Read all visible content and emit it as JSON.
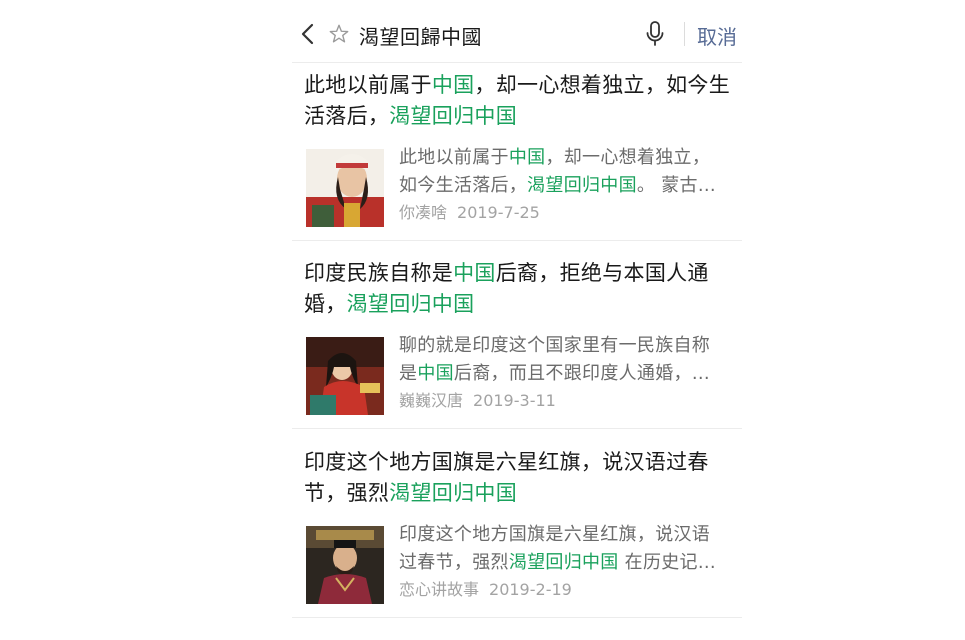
{
  "search": {
    "query": "渴望回歸中國",
    "cancel_label": "取消"
  },
  "icons": {
    "back": "chevron-left-icon",
    "star": "star-outline-icon",
    "mic": "microphone-icon"
  },
  "colors": {
    "highlight": "#1aa15c",
    "cancel": "#576b95",
    "snippet": "#6b6b6b",
    "meta": "#a3a3a3"
  },
  "results": [
    {
      "title_parts": [
        "此地以前属于",
        "中国",
        "，却一心想着独立，如今生活落后，",
        "渴望回归中国"
      ],
      "snippet_line1_parts": [
        "此地以前属于",
        "中国",
        "，却一心想着独立，"
      ],
      "snippet_line2_parts": [
        "如今生活落后，",
        "渴望回归中国",
        "。 蒙古..."
      ],
      "source": "你凑啥",
      "date": "2019-7-25"
    },
    {
      "title_parts": [
        "印度民族自称是",
        "中国",
        "后裔，拒绝与本国人通婚，",
        "渴望回归中国"
      ],
      "snippet_line1_parts": [
        "聊的就是印度这个国家里有一民族自称"
      ],
      "snippet_line2_parts": [
        "是",
        "中国",
        "后裔，而且不跟印度人通婚，..."
      ],
      "source": "巍巍汉唐",
      "date": "2019-3-11"
    },
    {
      "title_parts": [
        "印度这个地方国旗是六星红旗，说汉语过春节，强烈",
        "渴望回归中国"
      ],
      "snippet_line1_parts": [
        "印度这个地方国旗是六星红旗，说汉语"
      ],
      "snippet_line2_parts": [
        "过春节，强烈",
        "渴望回归中国",
        " 在历史记..."
      ],
      "source": "恋心讲故事",
      "date": "2019-2-19"
    }
  ]
}
